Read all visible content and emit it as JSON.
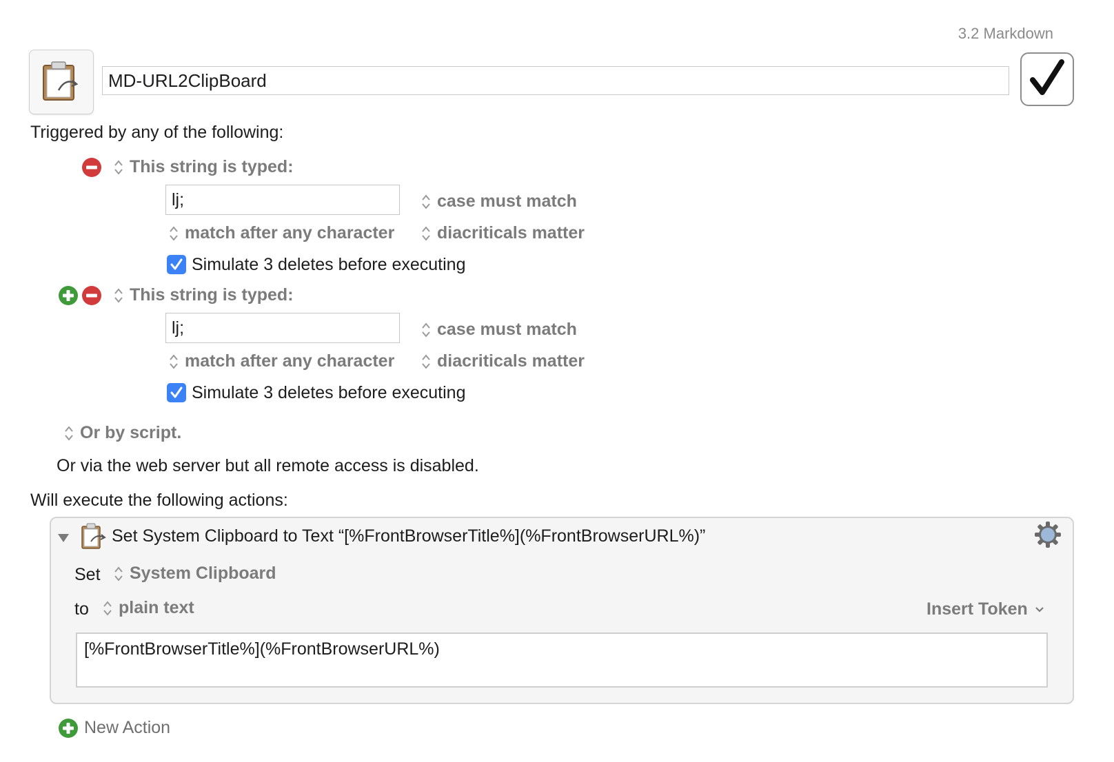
{
  "header": {
    "group_name": "3.2 Markdown",
    "macro_name": "MD-URL2ClipBoard",
    "icon": "clipboard-icon",
    "enable_icon": "checkmark-icon"
  },
  "triggers": {
    "heading": "Triggered by any of the following:",
    "items": [
      {
        "type_label": "This string is typed:",
        "typed_string": "lj;",
        "case_option": "case must match",
        "match_option": "match after any character",
        "diacritics_option": "diacriticals matter",
        "simulate_label": "Simulate 3 deletes before executing",
        "simulate_checked": true
      },
      {
        "type_label": "This string is typed:",
        "typed_string": "lj;",
        "case_option": "case must match",
        "match_option": "match after any character",
        "diacritics_option": "diacriticals matter",
        "simulate_label": "Simulate 3 deletes before executing",
        "simulate_checked": true
      }
    ],
    "script_option": "Or by script.",
    "web_server_note": "Or via the web server but all remote access is disabled."
  },
  "actions": {
    "heading": "Will execute the following actions:",
    "items": [
      {
        "title": "Set System Clipboard to Text “[%FrontBrowserTitle%](%FrontBrowserURL%)”",
        "set_label": "Set",
        "clipboard_option": "System Clipboard",
        "to_label": "to",
        "format_option": "plain text",
        "insert_token_label": "Insert Token",
        "text_value": "[%FrontBrowserTitle%](%FrontBrowserURL%)"
      }
    ],
    "new_action_label": "New Action"
  },
  "colors": {
    "remove_red": "#d13b3b",
    "add_green": "#3f9a3a",
    "checkbox_blue": "#3b82f6",
    "gear_blue": "#9db8d8"
  }
}
